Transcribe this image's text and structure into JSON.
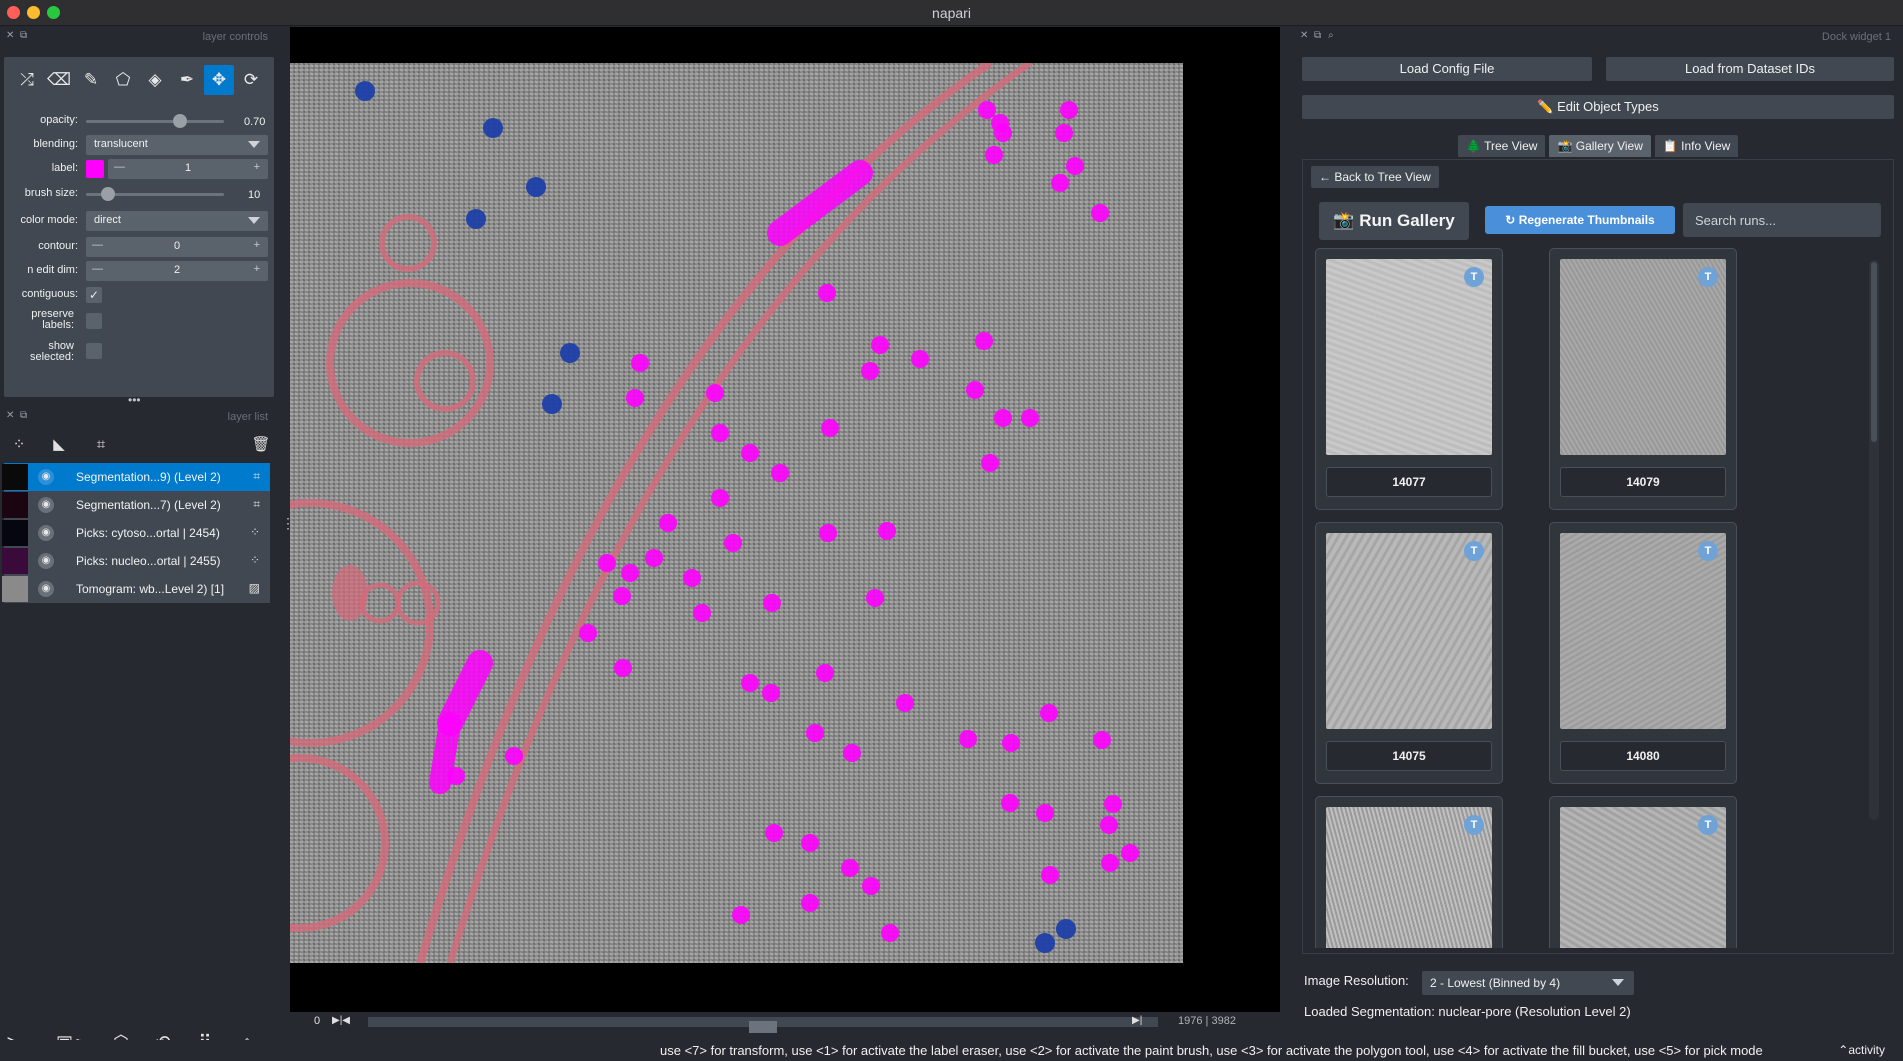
{
  "window": {
    "title": "napari"
  },
  "layer_controls": {
    "title": "layer controls",
    "tools": [
      "shuffle-icon",
      "eraser-icon",
      "brush-icon",
      "polygon-icon",
      "fill-bucket-icon",
      "picker-icon",
      "pan-zoom-icon",
      "transform-icon"
    ],
    "opacity": {
      "label": "opacity:",
      "value": "0.70",
      "fraction": 0.7
    },
    "blending": {
      "label": "blending:",
      "value": "translucent"
    },
    "label": {
      "label": "label:",
      "value": "1",
      "color": "#ff00ff"
    },
    "brush_size": {
      "label": "brush size:",
      "value": "10",
      "fraction": 0.12
    },
    "color_mode": {
      "label": "color mode:",
      "value": "direct"
    },
    "contour": {
      "label": "contour:",
      "value": "0"
    },
    "n_edit_dim": {
      "label": "n edit dim:",
      "value": "2"
    },
    "contiguous": {
      "label": "contiguous:",
      "checked": true
    },
    "preserve_labels": {
      "label": "preserve labels:",
      "checked": false
    },
    "show_selected": {
      "label": "show selected:",
      "checked": false
    }
  },
  "layer_list": {
    "title": "layer list",
    "layers": [
      {
        "name": "Segmentation...9) (Level 2)",
        "type": "labels",
        "selected": true
      },
      {
        "name": "Segmentation...7) (Level 2)",
        "type": "labels",
        "selected": false
      },
      {
        "name": "Picks: cytoso...ortal | 2454)",
        "type": "points",
        "selected": false
      },
      {
        "name": "Picks: nucleo...ortal | 2455)",
        "type": "points",
        "selected": false
      },
      {
        "name": "Tomogram: wb...Level 2) [1]",
        "type": "image",
        "selected": false
      }
    ]
  },
  "dims": {
    "start": "0",
    "position": "1976",
    "total": "3982",
    "slider_fraction": 0.5
  },
  "dock": {
    "title": "Dock widget 1",
    "load_config": "Load Config File",
    "load_dataset": "Load from Dataset IDs",
    "edit_types": "✏️ Edit Object Types",
    "tabs": {
      "tree": "Tree View",
      "gallery": "Gallery View",
      "info": "Info View"
    },
    "back": "← Back to Tree View",
    "run_gallery": "Run Gallery",
    "regenerate": "Regenerate Thumbnails",
    "search_placeholder": "Search runs...",
    "runs": [
      "14077",
      "14079",
      "14075",
      "14080",
      "",
      ""
    ],
    "image_resolution_label": "Image Resolution:",
    "image_resolution_value": "2 - Lowest (Binned by 4)",
    "loaded_segmentation": "Loaded Segmentation: nuclear-pore (Resolution Level 2)"
  },
  "status": {
    "message": "use <7> for transform, use <1> for activate the label eraser, use <2> for activate the paint brush, use <3> for activate the polygon tool, use <4> for activate the fill bucket, use <5> for pick mode",
    "activity": "activity"
  },
  "colors": {
    "accent": "#007acc",
    "magenta": "#ff00ff",
    "pick_blue": "#1f3fa8",
    "membrane": "#d46a7a"
  }
}
